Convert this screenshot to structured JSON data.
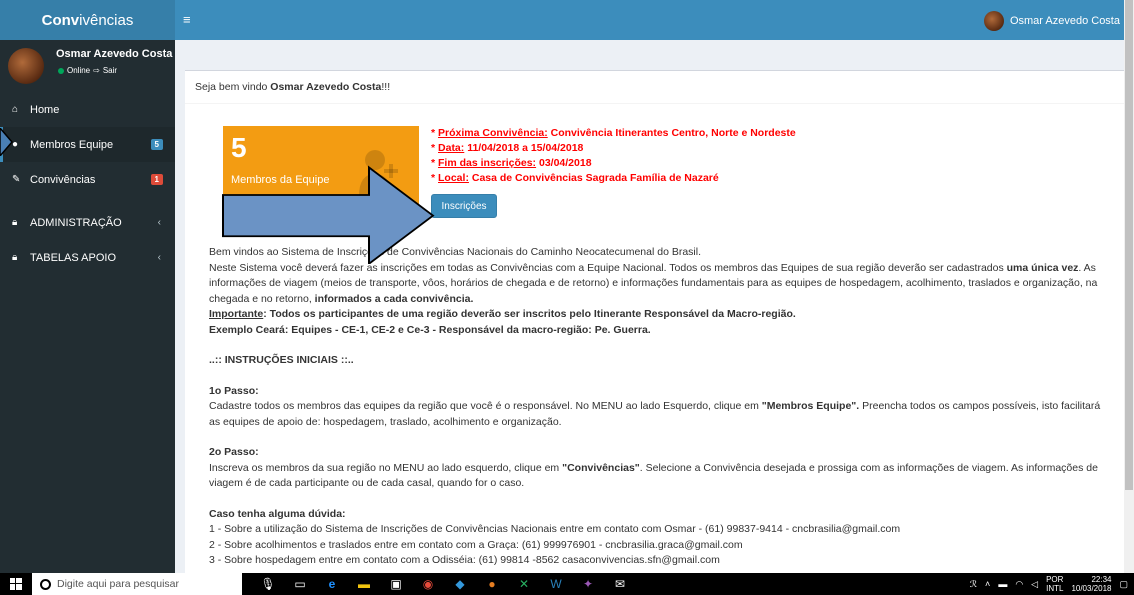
{
  "sidebar": {
    "logo_prefix": "Conv",
    "logo_suffix": "ivências",
    "user_name": "Osmar Azevedo Costa",
    "status_online": "Online",
    "status_logout": "Sair",
    "items": [
      {
        "label": "Home",
        "icon": "home-icon"
      },
      {
        "label": "Membros Equipe",
        "icon": "user-icon",
        "badge": "5",
        "badge_color": "#3c8dbc"
      },
      {
        "label": "Convivências",
        "icon": "edit-icon",
        "badge": "1",
        "badge_color": "#dd4b39"
      },
      {
        "label": "ADMINISTRAÇÃO",
        "icon": "lock-icon",
        "chevron": "‹"
      },
      {
        "label": "TABELAS APOIO",
        "icon": "lock-icon",
        "chevron": "‹"
      }
    ]
  },
  "topbar": {
    "toggle": "≡",
    "user_name": "Osmar Azevedo Costa"
  },
  "box": {
    "welcome_prefix": "Seja bem vindo ",
    "welcome_name": "Osmar Azevedo Costa",
    "welcome_suffix": "!!!"
  },
  "stat": {
    "number": "5",
    "label": "Membros da Equipe"
  },
  "info": {
    "l1_label": "Próxima Convivência:",
    "l1_value": " Convivência Itinerantes Centro, Norte e Nordeste",
    "l2_label": "Data:",
    "l2_value": " 11/04/2018 a 15/04/2018",
    "l3_label": "Fim das inscrições:",
    "l3_value": " 03/04/2018",
    "l4_label": "Local:",
    "l4_value": " Casa de Convivências Sagrada Família de Nazaré",
    "bullet": "* "
  },
  "button": {
    "label": "Inscrições"
  },
  "body": {
    "p1": "Bem vindos ao Sistema de Inscrições de Convivências Nacionais do Caminho Neocatecumenal do Brasil.",
    "p2a": "Neste Sistema você deverá fazer as inscrições em todas as Convivências com a Equipe Nacional. Todos os membros das Equipes de sua região deverão ser cadastrados ",
    "p2b": "uma única vez",
    "p2c": ". As informações de viagem (meios de transporte, vôos, horários de chegada e de retorno) e informações fundamentais para as equipes de hospedagem, acolhimento, traslados e organização, na chegada e no retorno, ",
    "p2d": "informados a cada convivência.",
    "important_label": "Importante",
    "important_text": ": Todos os participantes de uma região deverão ser inscritos pelo Itinerante Responsável da Macro-região.",
    "example": "Exemplo Ceará: Equipes - CE-1, CE-2 e Ce-3 - Responsável da macro-região: Pe. Guerra.",
    "instructions": "..:: INSTRUÇÕES INICIAIS ::..",
    "step1_title": "1o Passo:",
    "step1_a": "Cadastre todos os membros das equipes da região que você é o responsável. No MENU ao lado Esquerdo, clique em ",
    "step1_b": "\"Membros Equipe\".",
    "step1_c": " Preencha todos os campos possíveis, isto facilitará as equipes de apoio de: hospedagem, traslado, acolhimento e organização.",
    "step2_title": "2o Passo:",
    "step2_a": "Inscreva os membros da sua região no MENU ao lado esquerdo, clique em ",
    "step2_b": "\"Convivências\"",
    "step2_c": ". Selecione a Convivência desejada e prossiga com as informações de viagem. As informações de viagem é de cada participante ou de cada casal, quando for o caso.",
    "doubt_title": "Caso tenha alguma dúvida:",
    "doubt1": "1 - Sobre a utilização do Sistema de Inscrições de Convivências Nacionais entre em contato com Osmar - (61) 99837-9414 - cncbrasilia@gmail.com",
    "doubt2": "2 - Sobre acolhimentos e traslados entre em contato com a Graça: (61) 999976901 - cncbrasilia.graca@gmail.com",
    "doubt3": "3 - Sobre hospedagem entre em contato com a Odisséia: (61) 99814 -8562 casaconvivencias.sfn@gmail.com"
  },
  "taskbar": {
    "search_placeholder": "Digite aqui para pesquisar",
    "lang1": "POR",
    "lang2": "INTL",
    "time": "22:34",
    "date": "10/03/2018"
  }
}
